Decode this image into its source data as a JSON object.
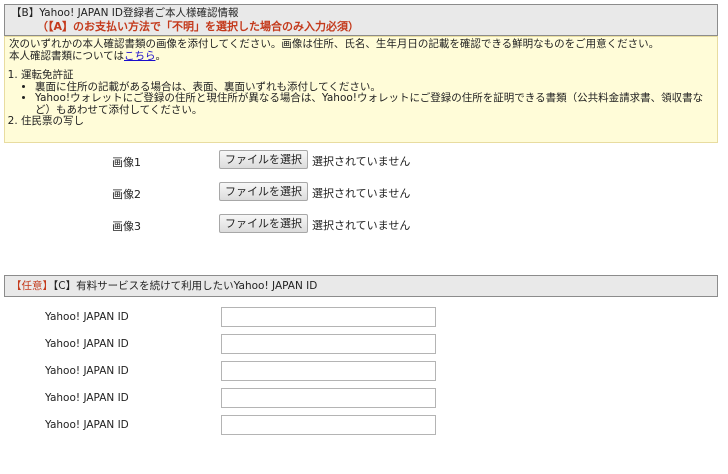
{
  "section_b": {
    "title": "【B】Yahoo! JAPAN ID登録者ご本人様確認情報",
    "subtitle": "（【A】のお支払い方法で「不明」を選択した場合のみ入力必須）"
  },
  "notice": {
    "intro": "次のいずれかの本人確認書類の画像を添付してください。画像は住所、氏名、生年月日の記載を確認できる鮮明なものをご用意ください。",
    "docs_prefix": "本人確認書類については",
    "docs_link": "こちら",
    "docs_suffix": "。",
    "items": [
      {
        "label": "運転免許証",
        "bullets": [
          "裏面に住所の記載がある場合は、表面、裏面いずれも添付してください。",
          "Yahoo!ウォレットにご登録の住所と現住所が異なる場合は、Yahoo!ウォレットにご登録の住所を証明できる書類（公共料金請求書、領収書など）もあわせて添付してください。"
        ]
      },
      {
        "label": "住民票の写し",
        "bullets": []
      }
    ]
  },
  "uploads": [
    {
      "label": "画像1",
      "button": "ファイルを選択",
      "status": "選択されていません"
    },
    {
      "label": "画像2",
      "button": "ファイルを選択",
      "status": "選択されていません"
    },
    {
      "label": "画像3",
      "button": "ファイルを選択",
      "status": "選択されていません"
    }
  ],
  "section_c": {
    "optional_tag": "【任意】",
    "title": "【C】有料サービスを続けて利用したいYahoo! JAPAN ID"
  },
  "id_fields": [
    {
      "label": "Yahoo! JAPAN ID",
      "value": "",
      "placeholder": ""
    },
    {
      "label": "Yahoo! JAPAN ID",
      "value": "",
      "placeholder": ""
    },
    {
      "label": "Yahoo! JAPAN ID",
      "value": "",
      "placeholder": ""
    },
    {
      "label": "Yahoo! JAPAN ID",
      "value": "",
      "placeholder": ""
    },
    {
      "label": "Yahoo! JAPAN ID",
      "value": "",
      "placeholder": ""
    }
  ],
  "colors": {
    "header_bg": "#e9e9e9",
    "notice_bg": "#fffcd8",
    "required_red": "#c43a1c",
    "link_blue": "#1a0dcc"
  }
}
